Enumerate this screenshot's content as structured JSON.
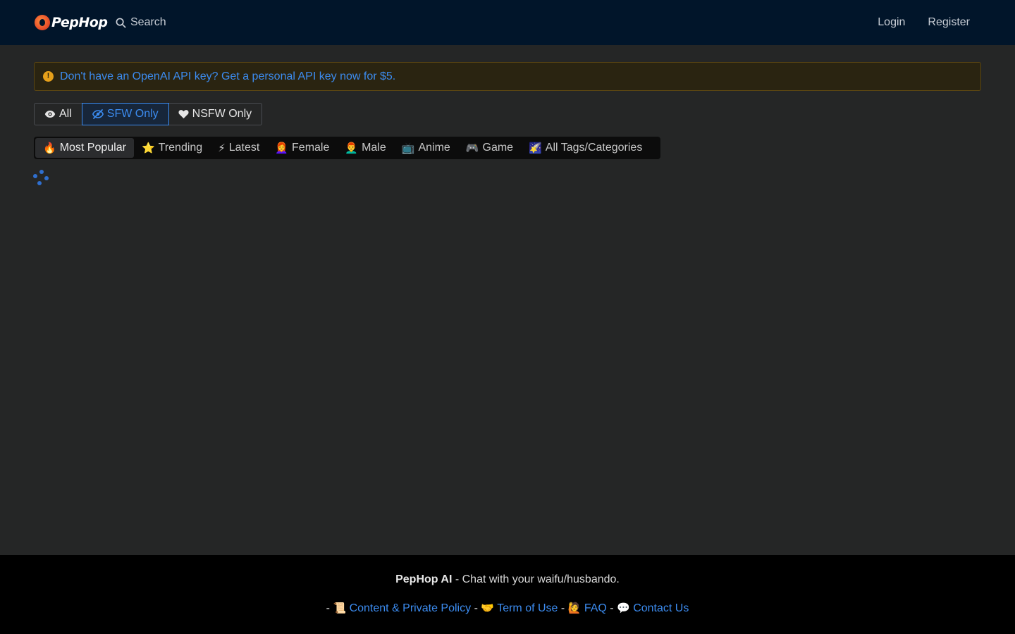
{
  "brand": {
    "name": "PepHop"
  },
  "nav": {
    "search_label": "Search",
    "login_label": "Login",
    "register_label": "Register"
  },
  "alert": {
    "icon": "!",
    "text": "Don't have an OpenAI API key? Get a personal API key now for $5."
  },
  "content_filter": {
    "selected": "SFW Only",
    "options": [
      {
        "label": "All",
        "icon": "eye-icon"
      },
      {
        "label": "SFW Only",
        "icon": "eye-slash-icon"
      },
      {
        "label": "NSFW Only",
        "icon": "heart-icon"
      }
    ]
  },
  "categories": {
    "selected": "Most Popular",
    "tabs": [
      {
        "emoji": "🔥",
        "label": "Most Popular"
      },
      {
        "emoji": "⭐",
        "label": "Trending"
      },
      {
        "emoji": "⚡",
        "label": "Latest"
      },
      {
        "emoji": "👩‍🦰",
        "label": "Female"
      },
      {
        "emoji": "👨‍🦰",
        "label": "Male"
      },
      {
        "emoji": "📺",
        "label": "Anime"
      },
      {
        "emoji": "🎮",
        "label": "Game"
      },
      {
        "emoji": "🌠",
        "label": "All Tags/Categories"
      }
    ]
  },
  "footer": {
    "brand": "PepHop AI",
    "tagline": " - Chat with your waifu/husbando.",
    "sep": " - ",
    "links": [
      {
        "emoji": "📜",
        "label": "Content & Private Policy"
      },
      {
        "emoji": "🤝",
        "label": "Term of Use"
      },
      {
        "emoji": "🙋",
        "label": "FAQ"
      },
      {
        "emoji": "💬",
        "label": "Contact Us"
      }
    ]
  },
  "colors": {
    "navbar_bg": "#01152a",
    "page_bg": "#252626",
    "link": "#3c8cf0",
    "alert_bg": "#2a2411",
    "alert_icon": "#e6a01a",
    "footer_bg": "#000000"
  }
}
